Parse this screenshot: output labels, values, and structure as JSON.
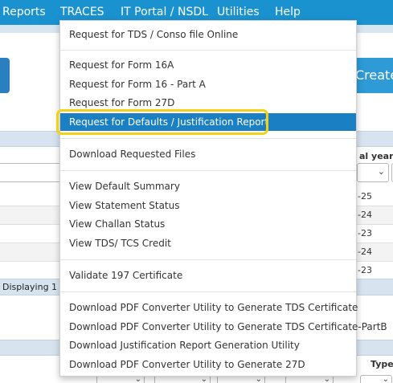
{
  "nav": {
    "items": [
      "Reports",
      "TRACES",
      "IT Portal / NSDL",
      "Utilities",
      "Help"
    ]
  },
  "page": {
    "create_label": "Create",
    "financial_year_header": "al year",
    "type_header": "Type",
    "rows": [
      "-25",
      "-24",
      "-23",
      "-24",
      "-23"
    ],
    "displaying_text": "Displaying 1 to 5"
  },
  "traces_menu": {
    "items": [
      "Request for TDS / Conso file Online",
      "Request for Form 16A",
      "Request for Form 16 - Part A",
      "Request for Form 27D",
      "Request for Defaults / Justification Report",
      "Download Requested Files",
      "View Default Summary",
      "View Statement Status",
      "View Challan Status",
      "View TDS/ TCS Credit",
      "Validate 197 Certificate",
      "Download PDF Converter Utility to Generate TDS Certificate",
      "Download PDF Converter Utility to Generate TDS Certificate-PartB",
      "Download Justification Report Generation Utility",
      "Download PDF Converter Utility to Generate 27D"
    ],
    "active_item": "Request for Defaults / Justification Report"
  },
  "colors": {
    "navbar": "#1a92d0",
    "menu_active": "#1b80c3",
    "highlight_ring": "#f3d113"
  }
}
